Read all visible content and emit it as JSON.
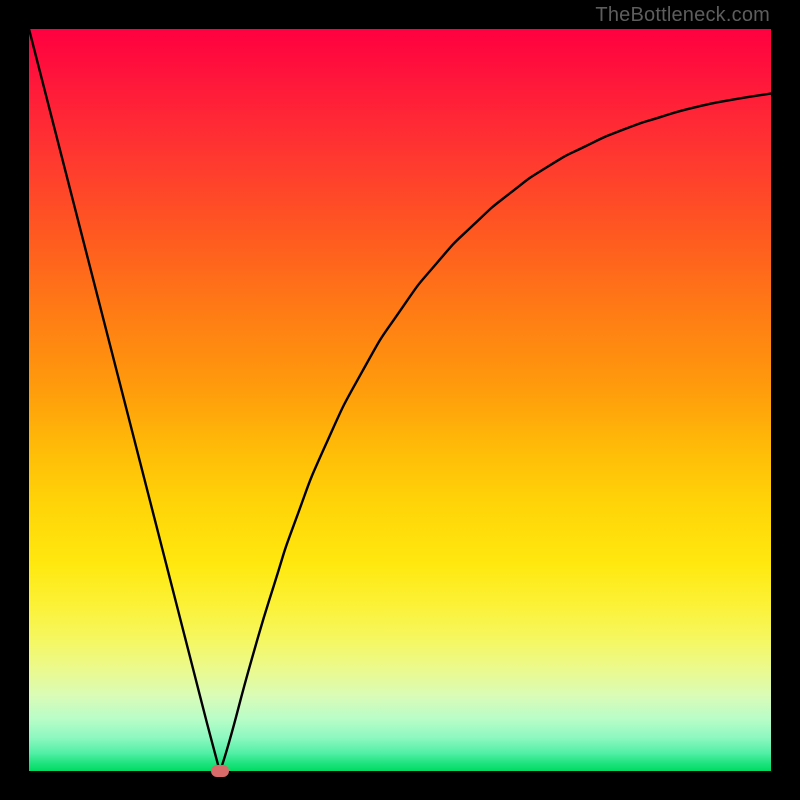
{
  "attribution": "TheBottleneck.com",
  "colors": {
    "curve_stroke": "#000000",
    "marker_fill": "#d86a6a"
  },
  "chart_data": {
    "type": "line",
    "title": "",
    "xlabel": "",
    "ylabel": "",
    "xlim": [
      0,
      100
    ],
    "ylim": [
      0,
      100
    ],
    "annotations": [],
    "series": [
      {
        "name": "bottleneck-curve",
        "x": [
          0,
          2,
          4,
          6,
          8,
          10,
          12,
          14,
          16,
          18,
          20,
          22,
          24,
          25.7,
          27,
          30,
          33,
          36,
          40,
          45,
          50,
          55,
          60,
          65,
          70,
          75,
          80,
          85,
          90,
          95,
          100
        ],
        "values": [
          100,
          92.2,
          84.4,
          76.6,
          68.8,
          61.0,
          53.2,
          45.4,
          37.6,
          29.8,
          22.0,
          14.2,
          6.4,
          0.0,
          4.0,
          15.0,
          25.0,
          34.0,
          44.0,
          54.0,
          62.0,
          68.5,
          73.7,
          78.0,
          81.5,
          84.2,
          86.4,
          88.1,
          89.5,
          90.5,
          91.3
        ]
      }
    ],
    "marker": {
      "x": 25.7,
      "y": 0
    },
    "gradient_background": true
  }
}
